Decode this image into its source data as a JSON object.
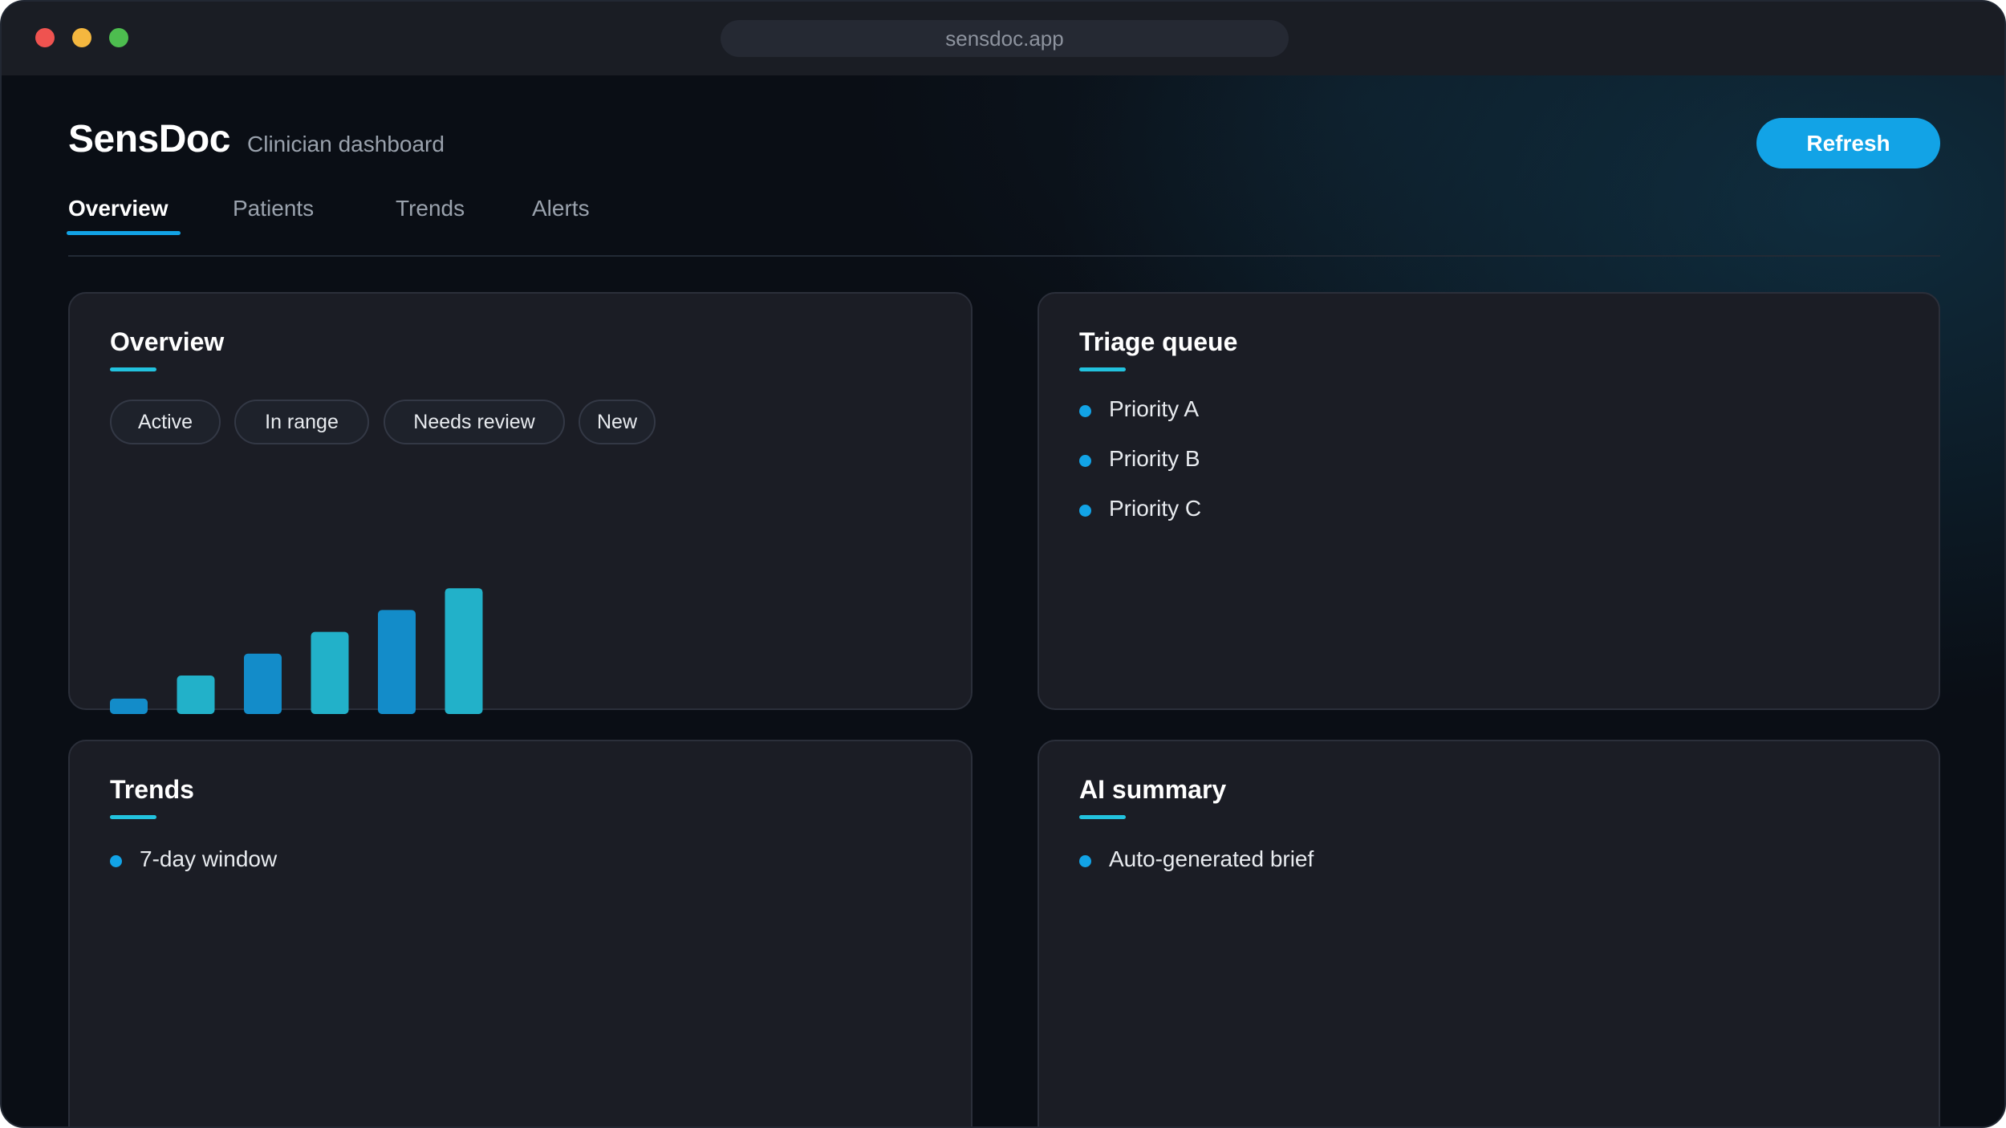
{
  "browser": {
    "url": "sensdoc.app"
  },
  "header": {
    "brand": "SensDoc",
    "subtitle": "Clinician dashboard",
    "refresh_label": "Refresh"
  },
  "tabs": [
    {
      "label": "Overview",
      "active": true
    },
    {
      "label": "Patients",
      "active": false
    },
    {
      "label": "Trends",
      "active": false
    },
    {
      "label": "Alerts",
      "active": false
    }
  ],
  "cards": {
    "overview": {
      "title": "Overview",
      "chips": [
        "Active",
        "In range",
        "Needs review",
        "New"
      ]
    },
    "triage": {
      "title": "Triage queue",
      "items": [
        "Priority A",
        "Priority B",
        "Priority C"
      ]
    },
    "trends": {
      "title": "Trends",
      "items": [
        "7-day window"
      ]
    },
    "ai_summary": {
      "title": "AI summary",
      "items": [
        "Auto-generated brief"
      ]
    }
  },
  "chart_data": {
    "type": "bar",
    "values": [
      1.2,
      3,
      4.7,
      6.4,
      8.1,
      9.8
    ],
    "ylim": [
      0,
      10
    ],
    "grid": false,
    "colors": [
      "#138cc9",
      "#22b1c9",
      "#138cc9",
      "#22b1c9",
      "#138cc9",
      "#22b1c9"
    ]
  },
  "colors": {
    "accent": "#12a3e6",
    "accent_secondary": "#22c2de",
    "card_background": "#1b1d25",
    "page_background": "#0a0e15"
  }
}
